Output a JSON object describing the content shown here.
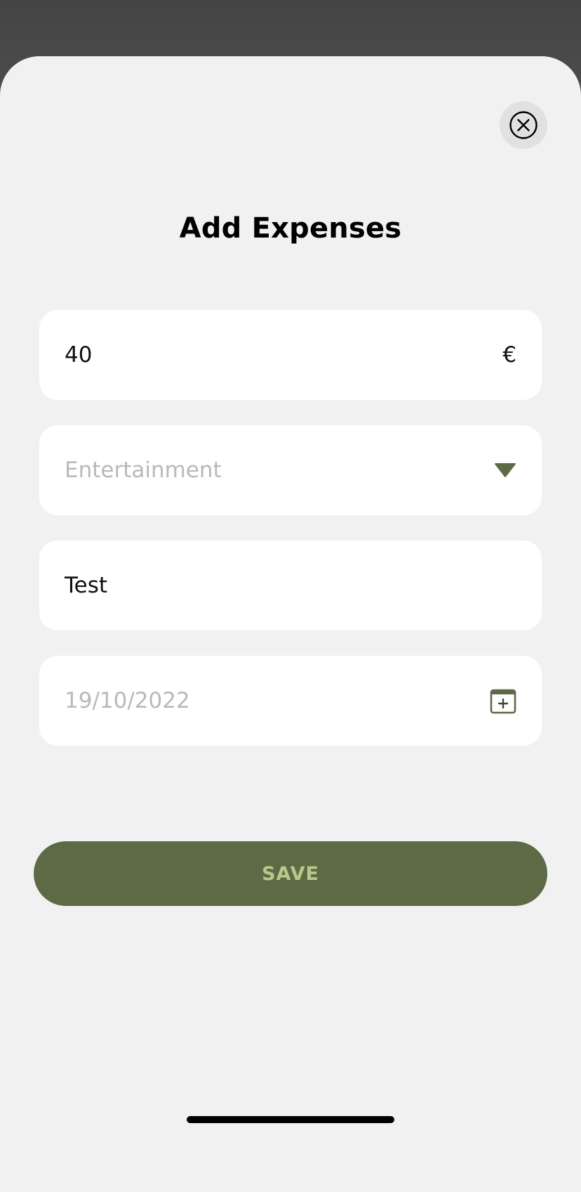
{
  "sheet": {
    "title": "Add Expenses"
  },
  "form": {
    "amount": {
      "value": "40",
      "currency_symbol": "€"
    },
    "category": {
      "placeholder": "Entertainment",
      "icon": "caret-down-icon"
    },
    "description": {
      "value": "Test"
    },
    "date": {
      "placeholder": "19/10/2022",
      "icon": "calendar-add-icon"
    }
  },
  "actions": {
    "save_label": "SAVE",
    "close_icon": "close-circle-icon"
  },
  "colors": {
    "accent": "#5c6a45",
    "accent_text": "#b7c98a",
    "sheet_background": "#f1f1f1",
    "field_background": "#ffffff",
    "placeholder": "#b9b9b9",
    "backdrop": "#4a4a4a"
  }
}
